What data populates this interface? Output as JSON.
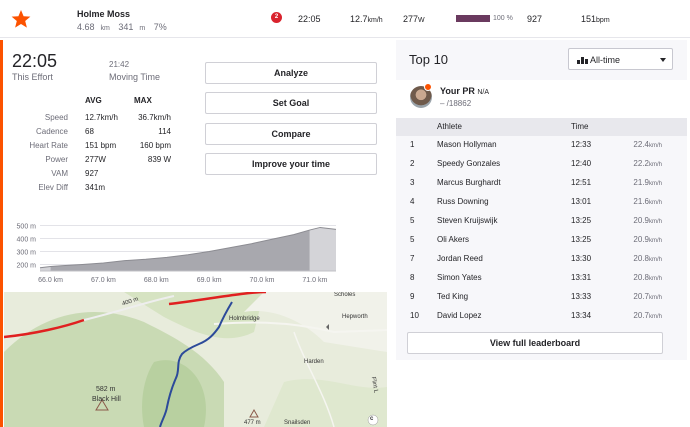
{
  "segment": {
    "name": "Holme Moss",
    "distance": "4.68",
    "distance_unit": "km",
    "elevation": "341",
    "elevation_unit": "m",
    "grade": "7%"
  },
  "effort_bar": {
    "rank_badge": "2",
    "time": "22:05",
    "speed": "12.7",
    "speed_unit": "km/h",
    "power": "277",
    "power_unit": "W",
    "percent": 100,
    "percent_label": "100 %",
    "vam": "927",
    "heart_rate": "151",
    "heart_rate_unit": "bpm"
  },
  "summary": {
    "effort_time": "22:05",
    "effort_label": "This Effort",
    "moving_time": "21:42",
    "moving_label": "Moving Time"
  },
  "stats": {
    "avg_header": "AVG",
    "max_header": "MAX",
    "rows": [
      {
        "label": "Speed",
        "avg": "12.7km/h",
        "max": "36.7km/h"
      },
      {
        "label": "Cadence",
        "avg": "68",
        "max": "114"
      },
      {
        "label": "Heart Rate",
        "avg": "151 bpm",
        "max": "160 bpm"
      },
      {
        "label": "Power",
        "avg": "277W",
        "max": "839 W"
      },
      {
        "label": "VAM",
        "avg": "927",
        "max": ""
      },
      {
        "label": "Elev Diff",
        "avg": "341m",
        "max": ""
      }
    ]
  },
  "actions": {
    "analyze": "Analyze",
    "set_goal": "Set Goal",
    "compare": "Compare",
    "improve": "Improve your time"
  },
  "chart_data": {
    "type": "area",
    "y_ticks": [
      "500 m",
      "400 m",
      "300 m",
      "200 m"
    ],
    "x_ticks": [
      "66.0 km",
      "67.0 km",
      "68.0 km",
      "69.0 km",
      "70.0 km",
      "71.0 km"
    ],
    "x": [
      65.8,
      66.0,
      66.2,
      66.6,
      67.0,
      67.4,
      67.8,
      68.2,
      68.6,
      69.0,
      69.4,
      69.8,
      70.2,
      70.6,
      70.9,
      71.1,
      71.4
    ],
    "y": [
      175,
      185,
      190,
      200,
      212,
      230,
      240,
      255,
      275,
      300,
      330,
      360,
      395,
      430,
      465,
      485,
      470
    ],
    "segment_range": [
      66.0,
      70.9
    ],
    "ylim": [
      150,
      550
    ],
    "xlim": [
      65.8,
      71.4
    ],
    "grid": true
  },
  "map": {
    "labels": {
      "road": "400 m",
      "town1": "Holmbridge",
      "town2": "Scholes",
      "town3": "Hepworth",
      "town4": "Harden",
      "peak_height": "582 m",
      "peak_name": "Black Hill",
      "peak2": "477 m",
      "place5": "Snailsden",
      "road2": "Flint L",
      "copyright": "c"
    }
  },
  "leaderboard": {
    "title": "Top 10",
    "filter": "All-time",
    "pr": {
      "label": "Your PR",
      "value": "N/A",
      "rank": "– /18862"
    },
    "headers": {
      "rank": "",
      "athlete": "Athlete",
      "time": "Time"
    },
    "rows": [
      {
        "rank": "1",
        "name": "Mason Hollyman",
        "time": "12:33",
        "speed": "22.4",
        "unit": "km/h"
      },
      {
        "rank": "2",
        "name": "Speedy Gonzales",
        "time": "12:40",
        "speed": "22.2",
        "unit": "km/h"
      },
      {
        "rank": "3",
        "name": "Marcus Burghardt",
        "time": "12:51",
        "speed": "21.9",
        "unit": "km/h"
      },
      {
        "rank": "4",
        "name": "Russ Downing",
        "time": "13:01",
        "speed": "21.6",
        "unit": "km/h"
      },
      {
        "rank": "5",
        "name": "Steven Kruijswijk",
        "time": "13:25",
        "speed": "20.9",
        "unit": "km/h"
      },
      {
        "rank": "5",
        "name": "Oli Akers",
        "time": "13:25",
        "speed": "20.9",
        "unit": "km/h"
      },
      {
        "rank": "7",
        "name": "Jordan Reed",
        "time": "13:30",
        "speed": "20.8",
        "unit": "km/h"
      },
      {
        "rank": "8",
        "name": "Simon Yates",
        "time": "13:31",
        "speed": "20.8",
        "unit": "km/h"
      },
      {
        "rank": "9",
        "name": "Ted King",
        "time": "13:33",
        "speed": "20.7",
        "unit": "km/h"
      },
      {
        "rank": "10",
        "name": "David Lopez",
        "time": "13:34",
        "speed": "20.7",
        "unit": "km/h"
      }
    ],
    "view_full": "View full leaderboard"
  },
  "colors": {
    "accent": "#fc5200",
    "badge": "#d9232d",
    "pct_bar": "#6a3a5f",
    "route": "#2c4a9a",
    "road": "#e02020"
  }
}
